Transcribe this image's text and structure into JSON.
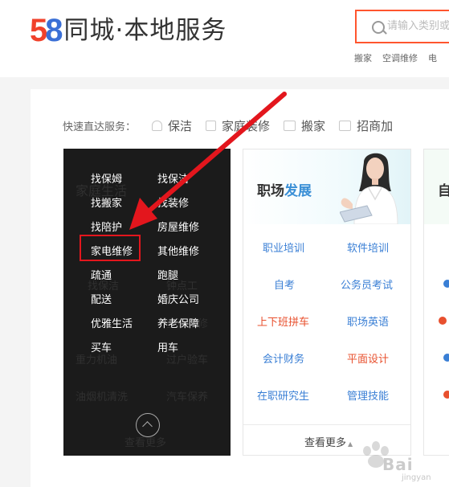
{
  "header": {
    "logo_number": {
      "five": "5",
      "eight": "8"
    },
    "logo_text": "同城·本地服务",
    "search_placeholder": "请输入类别或",
    "hot_links": [
      "搬家",
      "空调维修",
      "电"
    ]
  },
  "quick_services": {
    "label": "快速直达服务：",
    "items": [
      {
        "label": "保洁",
        "icon": "spray-bottle-icon"
      },
      {
        "label": "家庭装修",
        "icon": "paint-roller-icon"
      },
      {
        "label": "搬家",
        "icon": "truck-icon"
      },
      {
        "label": "招商加",
        "icon": "briefcase-icon"
      }
    ]
  },
  "dark_panel": {
    "ghost_title": "家庭生活",
    "ghost_items": [
      "找保洁",
      "钟点工",
      "空调维修",
      "管道疏通",
      "维修",
      "重力机油",
      "过户验车",
      "油烟机清洗",
      "汽车保养"
    ],
    "links": [
      [
        "找保姆",
        "找保洁"
      ],
      [
        "找搬家",
        "找装修"
      ],
      [
        "找陪护",
        "房屋维修"
      ],
      [
        "家电维修",
        "其他维修"
      ],
      [
        "疏通",
        "跑腿"
      ],
      [
        "配送",
        "婚庆公司"
      ],
      [
        "优雅生活",
        "养老保障"
      ],
      [
        "买车",
        "用车"
      ]
    ],
    "more_ghost": "查看更多"
  },
  "career_card": {
    "title_a": "职场",
    "title_b": "发展",
    "links": [
      [
        "职业培训",
        "软件培训"
      ],
      [
        "自考",
        "公务员考试"
      ],
      [
        "上下班拼车",
        "职场英语"
      ],
      [
        "会计财务",
        "平面设计"
      ],
      [
        "在职研究生",
        "管理技能"
      ]
    ],
    "link_colors": [
      [
        "#3a7fd5",
        "#3a7fd5"
      ],
      [
        "#3a7fd5",
        "#3a7fd5"
      ],
      [
        "#e8502e",
        "#3a7fd5"
      ],
      [
        "#3a7fd5",
        "#e8502e"
      ],
      [
        "#3a7fd5",
        "#3a7fd5"
      ]
    ],
    "more": "查看更多"
  },
  "next_card": {
    "title": "自",
    "fragment_colors": [
      "#3a7fd5",
      "#e8502e",
      "#3a7fd5",
      "#e8502e"
    ]
  },
  "watermark": {
    "text": "Bai",
    "sub": "jingyan"
  },
  "colors": {
    "accent": "#ff552e",
    "highlight": "#e3161d",
    "link": "#3a7fd5",
    "hot": "#e8502e"
  }
}
